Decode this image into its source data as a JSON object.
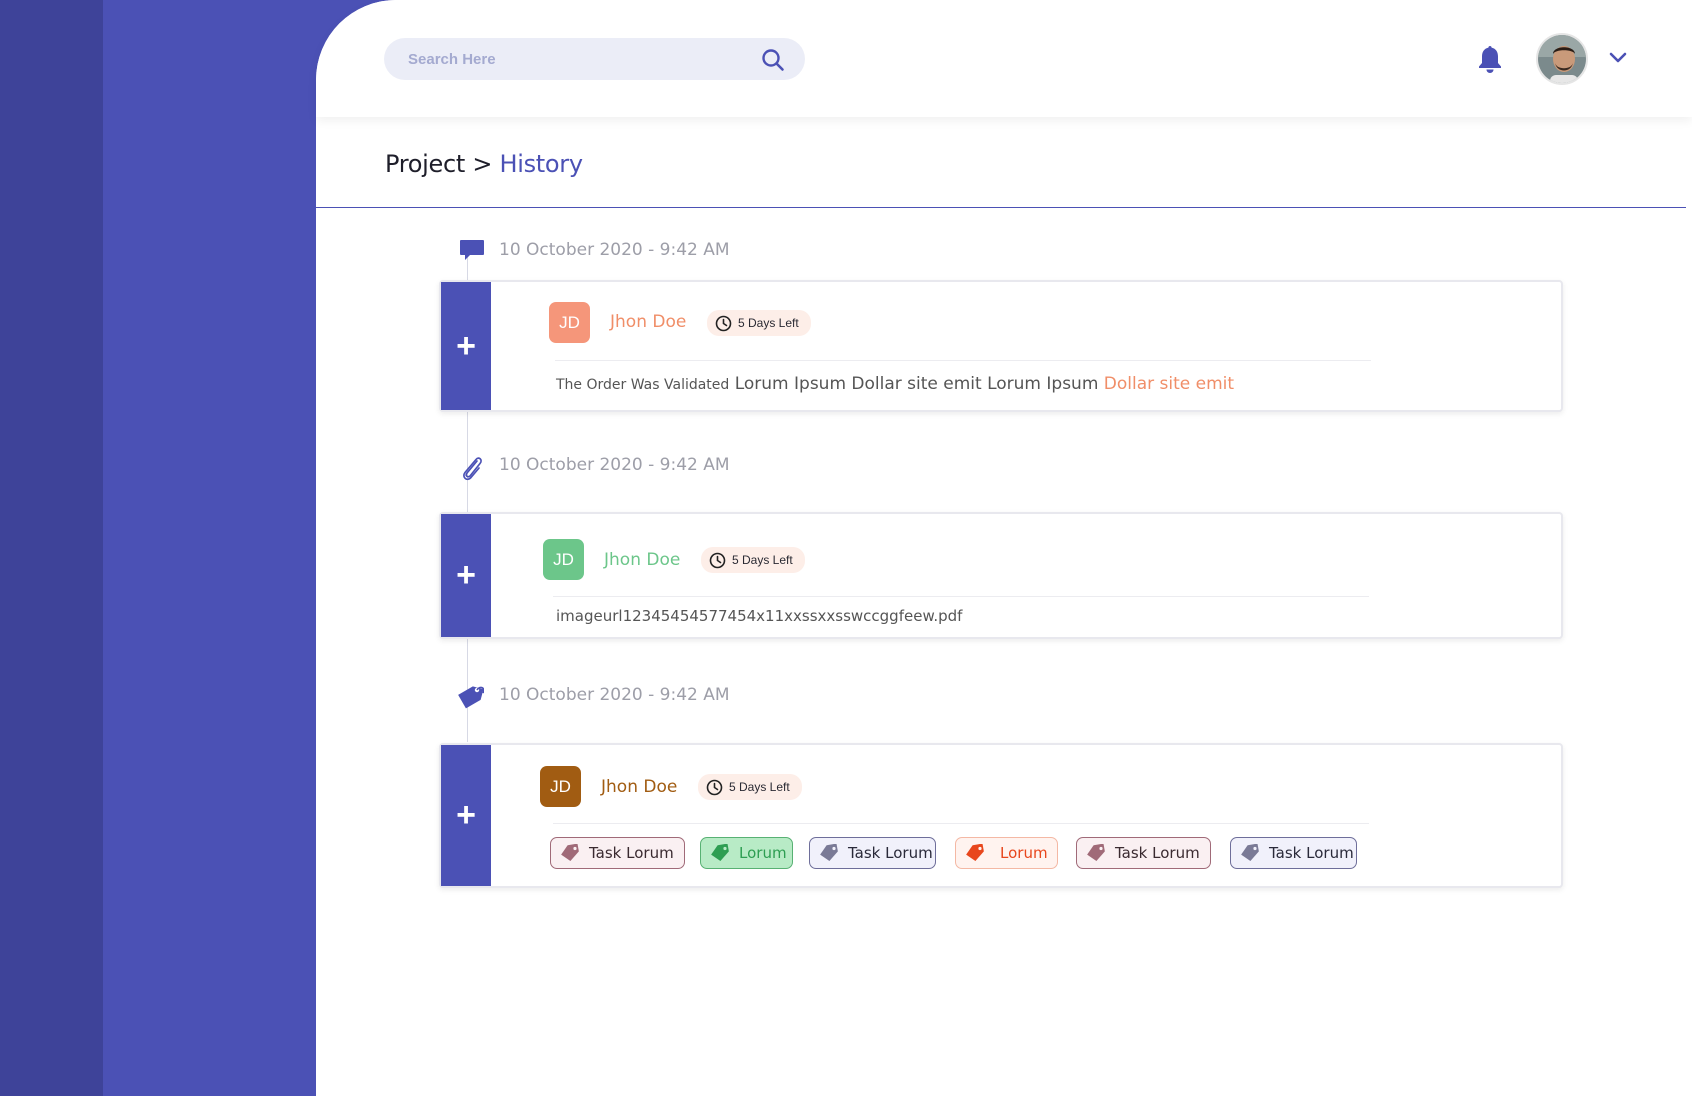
{
  "search": {
    "placeholder": "Search Here"
  },
  "breadcrumb": {
    "root": "Project",
    "separator": " > ",
    "current": "History"
  },
  "colors": {
    "primary": "#4b51b5",
    "accent_orange": "#f08e68",
    "accent_green": "#6cc68a",
    "accent_brown": "#a15c12"
  },
  "timeline": [
    {
      "icon": "comment-icon",
      "timestamp": "10 October 2020 - 9:42 AM",
      "plus": "+",
      "user": {
        "initials": "JD",
        "name": "Jhon Doe"
      },
      "deadline": "5 Days Left",
      "message": {
        "prefix": "The Order Was Validated",
        "body": "Lorum Ipsum Dollar site emit Lorum Ipsum",
        "highlight": "Dollar site emit"
      }
    },
    {
      "icon": "paperclip-icon",
      "timestamp": "10 October 2020 - 9:42 AM",
      "plus": "+",
      "user": {
        "initials": "JD",
        "name": "Jhon Doe"
      },
      "deadline": "5 Days Left",
      "file": "imageurl12345454577454x11xxssxxsswccggfeew.pdf"
    },
    {
      "icon": "tag-icon",
      "timestamp": "10 October 2020 - 9:42 AM",
      "plus": "+",
      "user": {
        "initials": "JD",
        "name": "Jhon Doe"
      },
      "deadline": "5 Days Left",
      "tags": [
        "Task Lorum",
        "Lorum",
        "Task Lorum",
        "Lorum",
        "Task Lorum",
        "Task Lorum"
      ]
    }
  ]
}
